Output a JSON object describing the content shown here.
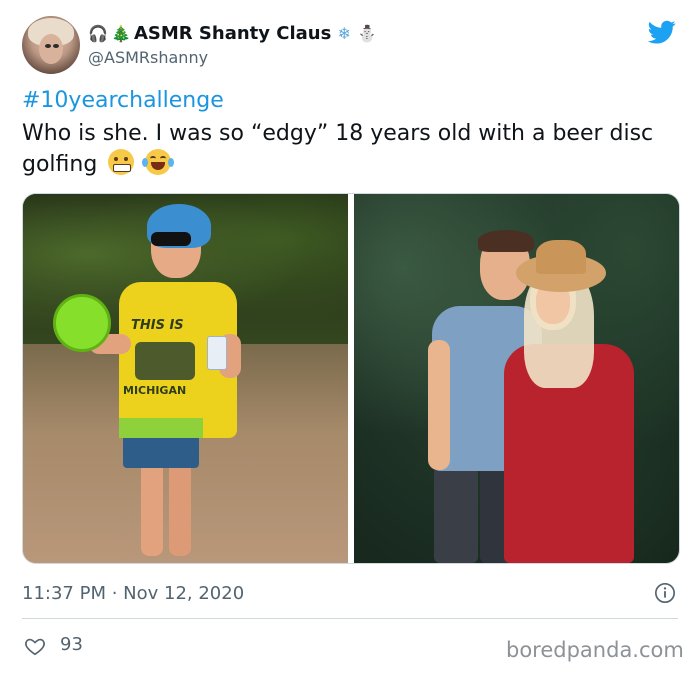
{
  "user": {
    "display_name": "ASMR Shanty Claus",
    "handle": "@ASMRshanny",
    "name_emoji_before": [
      "🎧",
      "🎄"
    ],
    "name_emoji_after": [
      "❄",
      "⛄"
    ]
  },
  "tweet": {
    "hashtag": "#10yearchallenge",
    "text": "Who is she. I was so “edgy” 18 years old with a beer disc golfing",
    "emojis": [
      "grimacing-face",
      "tears-of-joy-face"
    ],
    "timestamp": "11:37 PM · Nov 12, 2020",
    "likes": "93"
  },
  "photo_left_shirt_text": [
    "THIS IS",
    "MICHIGAN"
  ],
  "watermark": "boredpanda.com",
  "colors": {
    "link": "#1b95e0",
    "twitter_blue": "#1da1f2",
    "secondary_text": "#536471"
  }
}
